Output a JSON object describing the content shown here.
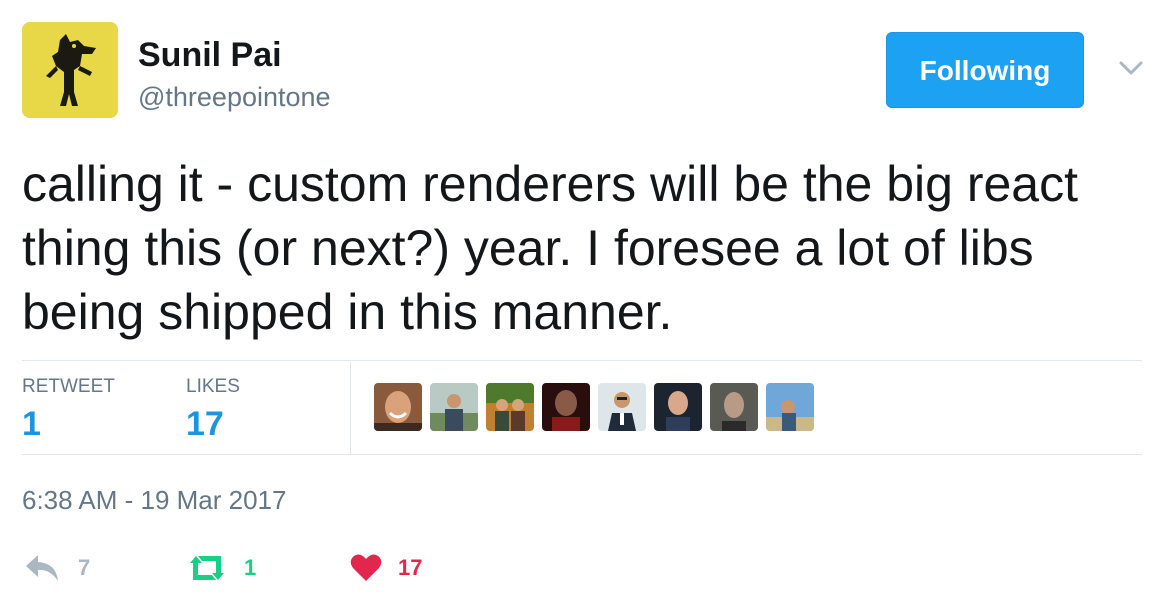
{
  "user": {
    "name": "Sunil Pai",
    "handle": "@threepointone"
  },
  "follow_button": {
    "label": "Following",
    "color": "#1da1f2"
  },
  "tweet": {
    "text": "calling it - custom renderers will be the big react thing this (or next?) year. I foresee a lot of libs being shipped in this manner."
  },
  "stats": {
    "retweet_label": "RETWEET",
    "retweet_count": "1",
    "likes_label": "LIKES",
    "likes_count": "17",
    "count_color": "#1b95e0"
  },
  "likers": [
    {
      "icon": "avatar-bald-smiling-man"
    },
    {
      "icon": "avatar-man-outdoors"
    },
    {
      "icon": "avatar-two-people-outdoors"
    },
    {
      "icon": "avatar-man-dark-red"
    },
    {
      "icon": "avatar-man-suit"
    },
    {
      "icon": "avatar-man-dark-blue"
    },
    {
      "icon": "avatar-man-grey"
    },
    {
      "icon": "avatar-man-blue-sky"
    }
  ],
  "timestamp": "6:38 AM - 19 Mar 2017",
  "actions": {
    "reply": {
      "icon": "reply-icon",
      "count": "7",
      "color": "#aab8c2"
    },
    "retweet": {
      "icon": "retweet-icon",
      "count": "1",
      "color": "#19cf86"
    },
    "like": {
      "icon": "heart-icon",
      "count": "17",
      "color": "#e2264d"
    }
  }
}
